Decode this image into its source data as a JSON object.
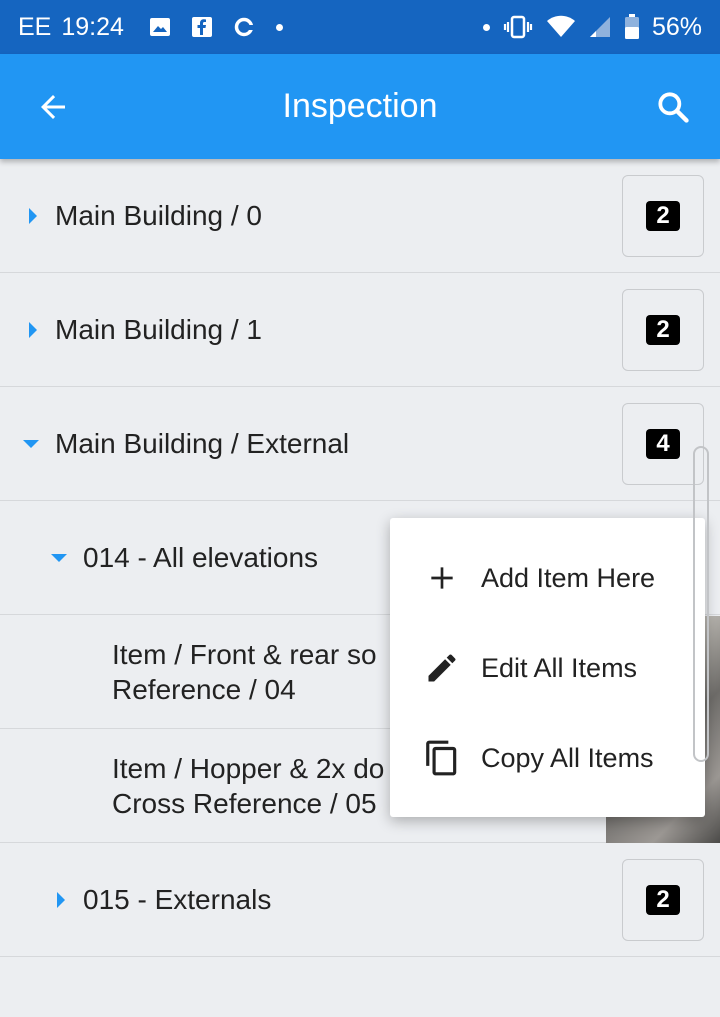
{
  "status_bar": {
    "carrier": "EE",
    "time": "19:24",
    "battery": "56%",
    "icons": [
      "image-icon",
      "facebook-icon",
      "sync-icon",
      "dot-icon",
      "dot-icon",
      "vibrate-icon",
      "wifi-icon",
      "signal-icon",
      "battery-icon"
    ]
  },
  "app_bar": {
    "title": "Inspection",
    "back_icon": "arrow-back-icon",
    "search_icon": "search-icon",
    "color": "#2196f3"
  },
  "list": {
    "rows": [
      {
        "label": "Main Building / 0",
        "badge": "2",
        "expanded": false
      },
      {
        "label": "Main Building / 1",
        "badge": "2",
        "expanded": false
      },
      {
        "label": "Main Building / External",
        "badge": "4",
        "expanded": true
      },
      {
        "label": "014 - All elevations",
        "expanded": true
      },
      {
        "line1": "Item / Front & rear so",
        "line2": "Reference / 04"
      },
      {
        "line1": "Item / Hopper & 2x do",
        "line2": "Cross Reference / 05"
      },
      {
        "label": "015 - Externals",
        "badge": "2",
        "expanded": false
      }
    ]
  },
  "context_menu": {
    "items": [
      {
        "label": "Add Item Here",
        "icon": "plus-icon"
      },
      {
        "label": "Edit All Items",
        "icon": "pencil-icon"
      },
      {
        "label": "Copy All Items",
        "icon": "copy-icon"
      }
    ]
  },
  "colors": {
    "accent": "#2196f3",
    "status_bar": "#1565c0",
    "caret": "#2196f3",
    "badge": "#000000"
  }
}
